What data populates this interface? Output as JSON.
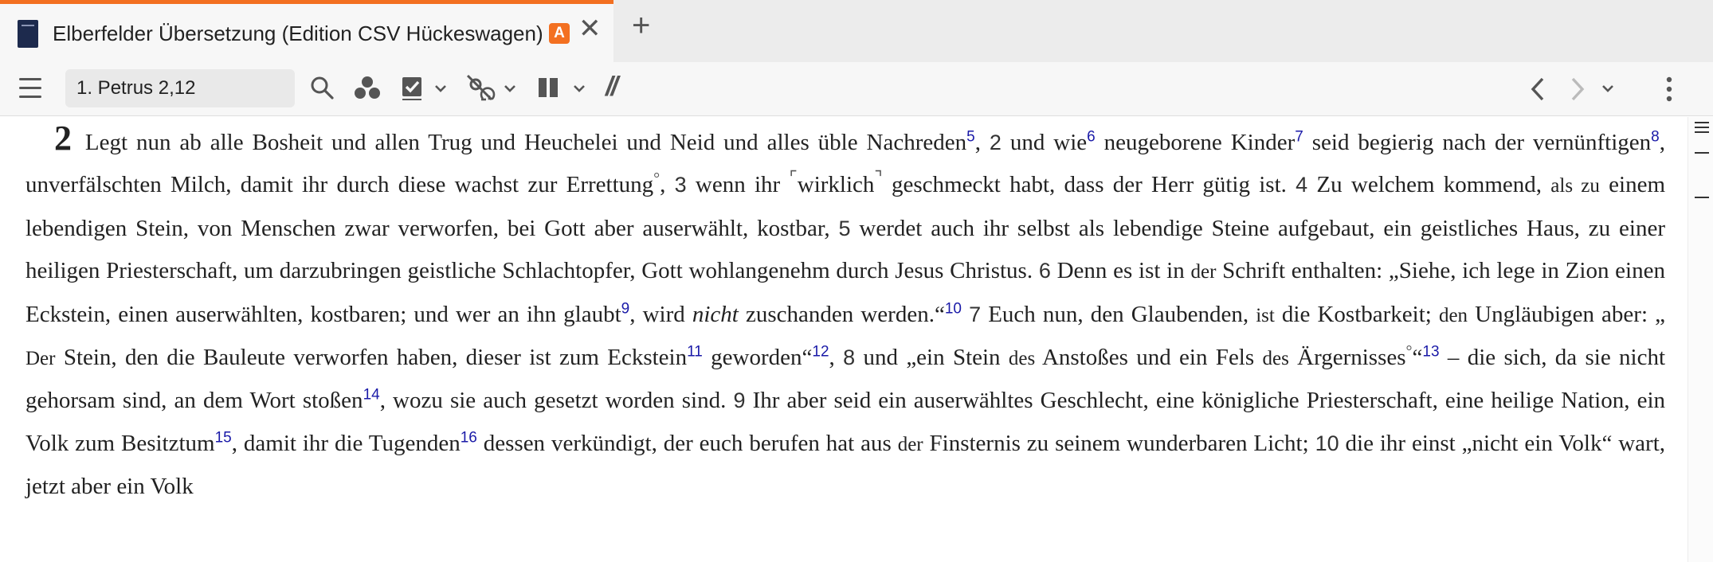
{
  "tab": {
    "title": "Elberfelder Übersetzung (Edition CSV Hückeswagen)",
    "badge": "A",
    "close": "✕",
    "add": "+"
  },
  "toolbar": {
    "reference": "1. Petrus 2,12",
    "parallel": "//",
    "accent_color": "#f37021"
  },
  "passage": {
    "chapter": "2",
    "t1": " Legt nun ab alle Bosheit und allen Trug und Heuchelei und Neid und alles üble Nachreden",
    "f5": "5",
    "v2": "2",
    "t2a": " und wie",
    "f6": "6",
    "t2b": " neugeborene Kinder",
    "f7": "7",
    "t2c": " seid begierig nach der vernünftigen",
    "f8": "8",
    "t2d": ", unverfälschten Milch, damit ihr durch diese wachst zur Errettung",
    "deg1": "°",
    "t2e": ", ",
    "v3": "3",
    "t3a": " wenn ihr ",
    "t3w": "wirklich",
    "t3b": " geschmeckt habt, dass der Herr gütig ist. ",
    "v4": "4",
    "t4a": " Zu welchem kommend, ",
    "t4s": "als zu",
    "t4b": " einem lebendigen Stein, von Menschen zwar verworfen, bei Gott aber auserwählt, kostbar, ",
    "v5": "5",
    "t5": " werdet auch ihr selbst als lebendige Steine aufgebaut, ein geistliches Haus, zu einer heiligen Priesterschaft, um darzubringen geistliche Schlachtopfer, Gott wohlangenehm durch Jesus Christus. ",
    "v6": "6",
    "t6a": " Denn es ist in ",
    "t6s": "der",
    "t6b": " Schrift enthalten: „Siehe, ich lege in Zion einen Eckstein, einen auserwählten, kostbaren; und wer an ihn glaubt",
    "f9": "9",
    "t6c": ", wird ",
    "t6i": "nicht",
    "t6d": " zuschanden werden.“",
    "f10": "10",
    "t6e": " ",
    "v7": "7",
    "t7a": " Euch nun, den Glaubenden, ",
    "t7s1": "ist",
    "t7b": " die Kostbarkeit; ",
    "t7s2": "den",
    "t7c": " Ungläubigen aber: „ ",
    "t7s3": "Der",
    "t7d": " Stein, den die Bauleute verworfen haben, dieser ist zum Eckstein",
    "f11": "11",
    "t7e": " geworden“",
    "f12": "12",
    "t7f": ", ",
    "v8": "8",
    "t8a": " und „ein Stein ",
    "t8s1": "des",
    "t8b": " Anstoßes und ein Fels ",
    "t8s2": "des",
    "t8c": " Ärgernisses",
    "deg2": "°",
    "t8d": "“",
    "f13": "13",
    "t8e": " – die sich, da sie nicht gehorsam sind, an dem Wort stoßen",
    "f14": "14",
    "t8f": ", wozu sie auch gesetzt worden sind. ",
    "v9": "9",
    "t9a": " Ihr aber seid ein auserwähltes Geschlecht, eine königliche Priesterschaft, eine heilige Nation, ein Volk zum Besitztum",
    "f15": "15",
    "t9b": ", damit ihr die Tugenden",
    "f16": "16",
    "t9c": " dessen verkündigt, der euch berufen hat aus ",
    "t9s": "der",
    "t9d": " Finsternis zu seinem wunderbaren Licht; ",
    "v10": "10",
    "t10a": " die ihr einst „nicht ein Volk“ wart, jetzt aber ein Volk"
  }
}
